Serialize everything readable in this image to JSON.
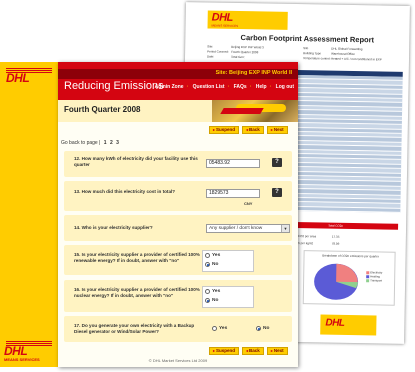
{
  "report": {
    "logo_text": "DHL",
    "logo_sub": "MEANS SERVICES",
    "title": "Carbon Footprint Assessment Report",
    "meta_left": [
      "Site:",
      "Period Covered:",
      "Date:"
    ],
    "meta_left_values": [
      "Beijing EXP INP World 3",
      "Fourth Quarter 2008",
      "Total Gen:"
    ],
    "meta_right": [
      "Site",
      "Building Type",
      "Temperature control:"
    ],
    "meta_right_values": [
      "DHL Global Forwarding",
      "Warehouse/Office",
      "Heated + A/C / not conditioned in EXP"
    ],
    "total_label": "Total CO2e",
    "summary_rows": [
      "kg CO2 per area",
      "kWh per kgm2"
    ],
    "summary_values": [
      "17.35",
      "78.09"
    ],
    "pie_title": "Breakdown of CO2e emissions per quarter",
    "pie_legend": [
      "Electricity",
      "Heating",
      "Transport"
    ],
    "pie_colors": [
      "#f08080",
      "#5b5bd6",
      "#8fd08f"
    ],
    "footnote": "* Additional emission sources listed in report on following pages.",
    "footer_logo": "DHL"
  },
  "band": {
    "logo": "DHL",
    "logo_bottom": "DHL",
    "sub": "MEANS SERVICES"
  },
  "header": {
    "site": "Site: Beijing EXP INP World II",
    "title": "Reducing Emissions",
    "nav": [
      "Admin Zone",
      "Question List",
      "FAQs",
      "Help",
      "Log out"
    ],
    "page_title": "Fourth Quarter 2008"
  },
  "buttons": {
    "suspend": "Suspend",
    "back": "Back",
    "next": "Next"
  },
  "goback": {
    "label": "Go back to page |",
    "pages": [
      "1",
      "2",
      "3"
    ]
  },
  "questions": [
    {
      "text": "12. How many kWh of electricity did your facility use this quarter",
      "value": "05483.92",
      "help": "?"
    },
    {
      "text": "13. How much did this electricity cost in total?",
      "value": "1829573",
      "unit": "CNY",
      "help": "?"
    },
    {
      "text": "14. Who is your electricity supplier?",
      "select": "Any supplier / don't know"
    },
    {
      "text": "15. Is your electricity supplier a provider of certified 100% renewable energy? If in doubt, answer with \"no\"",
      "options": [
        "Yes",
        "No"
      ],
      "selected": "No"
    },
    {
      "text": "16. Is your electricity supplier a provider of certified 100% nuclear energy? If in doubt, answer with \"no\"",
      "options": [
        "Yes",
        "No"
      ],
      "selected": "No"
    },
    {
      "text": "17. Do you generate your own electricity with a Backup Diesel generator or Wind/Solar Power?",
      "options": [
        "Yes",
        "No"
      ],
      "selected": "No"
    }
  ],
  "footer": {
    "copyright": "© DHL Market Services Ltd 2009"
  },
  "colors": {
    "dhl_red": "#d40511",
    "dhl_yellow": "#ffcc00",
    "panel": "#fff3c2"
  }
}
